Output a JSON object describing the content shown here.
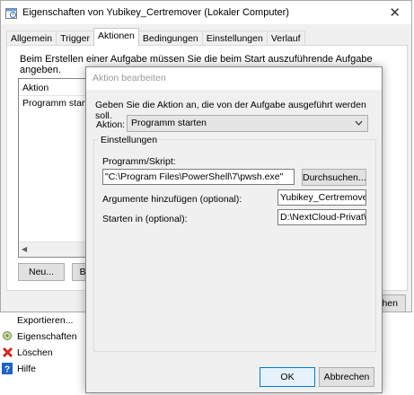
{
  "outer": {
    "title": "Eigenschaften von Yubikey_Certremover (Lokaler Computer)",
    "close_glyph": "✕",
    "tabs": [
      "Allgemein",
      "Trigger",
      "Aktionen",
      "Bedingungen",
      "Einstellungen",
      "Verlauf"
    ],
    "active_tab": "Aktionen",
    "intro_text": "Beim Erstellen einer Aufgabe müssen Sie die beim Start auszuführende Aufgabe angeben.",
    "list_header": "Aktion",
    "list_row": "Programm starten",
    "new_button": "Neu...",
    "edit_button_partial": "Be",
    "ok_partial": "chen"
  },
  "menu": {
    "items": [
      {
        "label": "Exportieren...",
        "icon": "none"
      },
      {
        "label": "Eigenschaften",
        "icon": "properties-icon"
      },
      {
        "label": "Löschen",
        "icon": "delete-icon"
      },
      {
        "label": "Hilfe",
        "icon": "help-icon"
      }
    ]
  },
  "dialog": {
    "title": "Aktion bearbeiten",
    "description": "Geben Sie die Aktion an, die von der Aufgabe ausgeführt werden soll.",
    "action_label": "Aktion:",
    "action_value": "Programm starten",
    "group_label": "Einstellungen",
    "program_label": "Programm/Skript:",
    "program_value": "\"C:\\Program Files\\PowerShell\\7\\pwsh.exe\"",
    "browse_button": "Durchsuchen...",
    "args_label": "Argumente hinzufügen (optional):",
    "args_value": "Yubikey_Certremover.ps",
    "start_label": "Starten in (optional):",
    "start_value": "D:\\NextCloud-Privat\\Too",
    "ok_button": "OK",
    "cancel_button": "Abbrechen"
  },
  "colors": {
    "accent": "#0078d7",
    "delete_red": "#d9261c",
    "help_blue": "#1e63c6"
  }
}
